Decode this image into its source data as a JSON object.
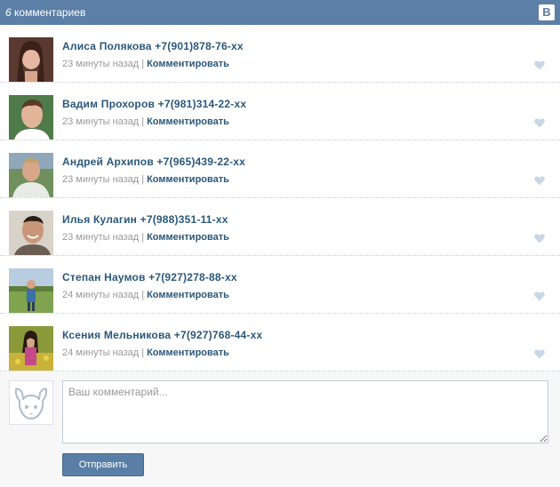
{
  "header": {
    "count": "6",
    "label": "комментариев",
    "logo_letter": "В"
  },
  "comments": [
    {
      "name": "Алиса  Полякова +7(901)878-76-xx",
      "time": "23 минуты назад",
      "reply": "Комментировать",
      "avatar": "avatar-woman-portrait"
    },
    {
      "name": "Вадим  Прохоров +7(981)314-22-xx",
      "time": "23 минуты назад",
      "reply": "Комментировать",
      "avatar": "avatar-man-portrait"
    },
    {
      "name": "Андрей  Архипов +7(965)439-22-xx",
      "time": "23 минуты назад",
      "reply": "Комментировать",
      "avatar": "avatar-man-outdoor"
    },
    {
      "name": "Илья  Кулагин +7(988)351-11-xx",
      "time": "23 минуты назад",
      "reply": "Комментировать",
      "avatar": "avatar-man-smiling"
    },
    {
      "name": "Степан  Наумов +7(927)278-88-xx",
      "time": "24 минуты назад",
      "reply": "Комментировать",
      "avatar": "avatar-man-landscape"
    },
    {
      "name": "Ксения  Мельникова +7(927)768-44-xx",
      "time": "24 минуты назад",
      "reply": "Комментировать",
      "avatar": "avatar-woman-field"
    }
  ],
  "composer": {
    "placeholder": "Ваш комментарий...",
    "send_label": "Отправить"
  },
  "colors": {
    "header_bg": "#5b7fa6",
    "name_color": "#2b587a",
    "meta_color": "#999999",
    "heart_color": "#c9d6e6"
  }
}
